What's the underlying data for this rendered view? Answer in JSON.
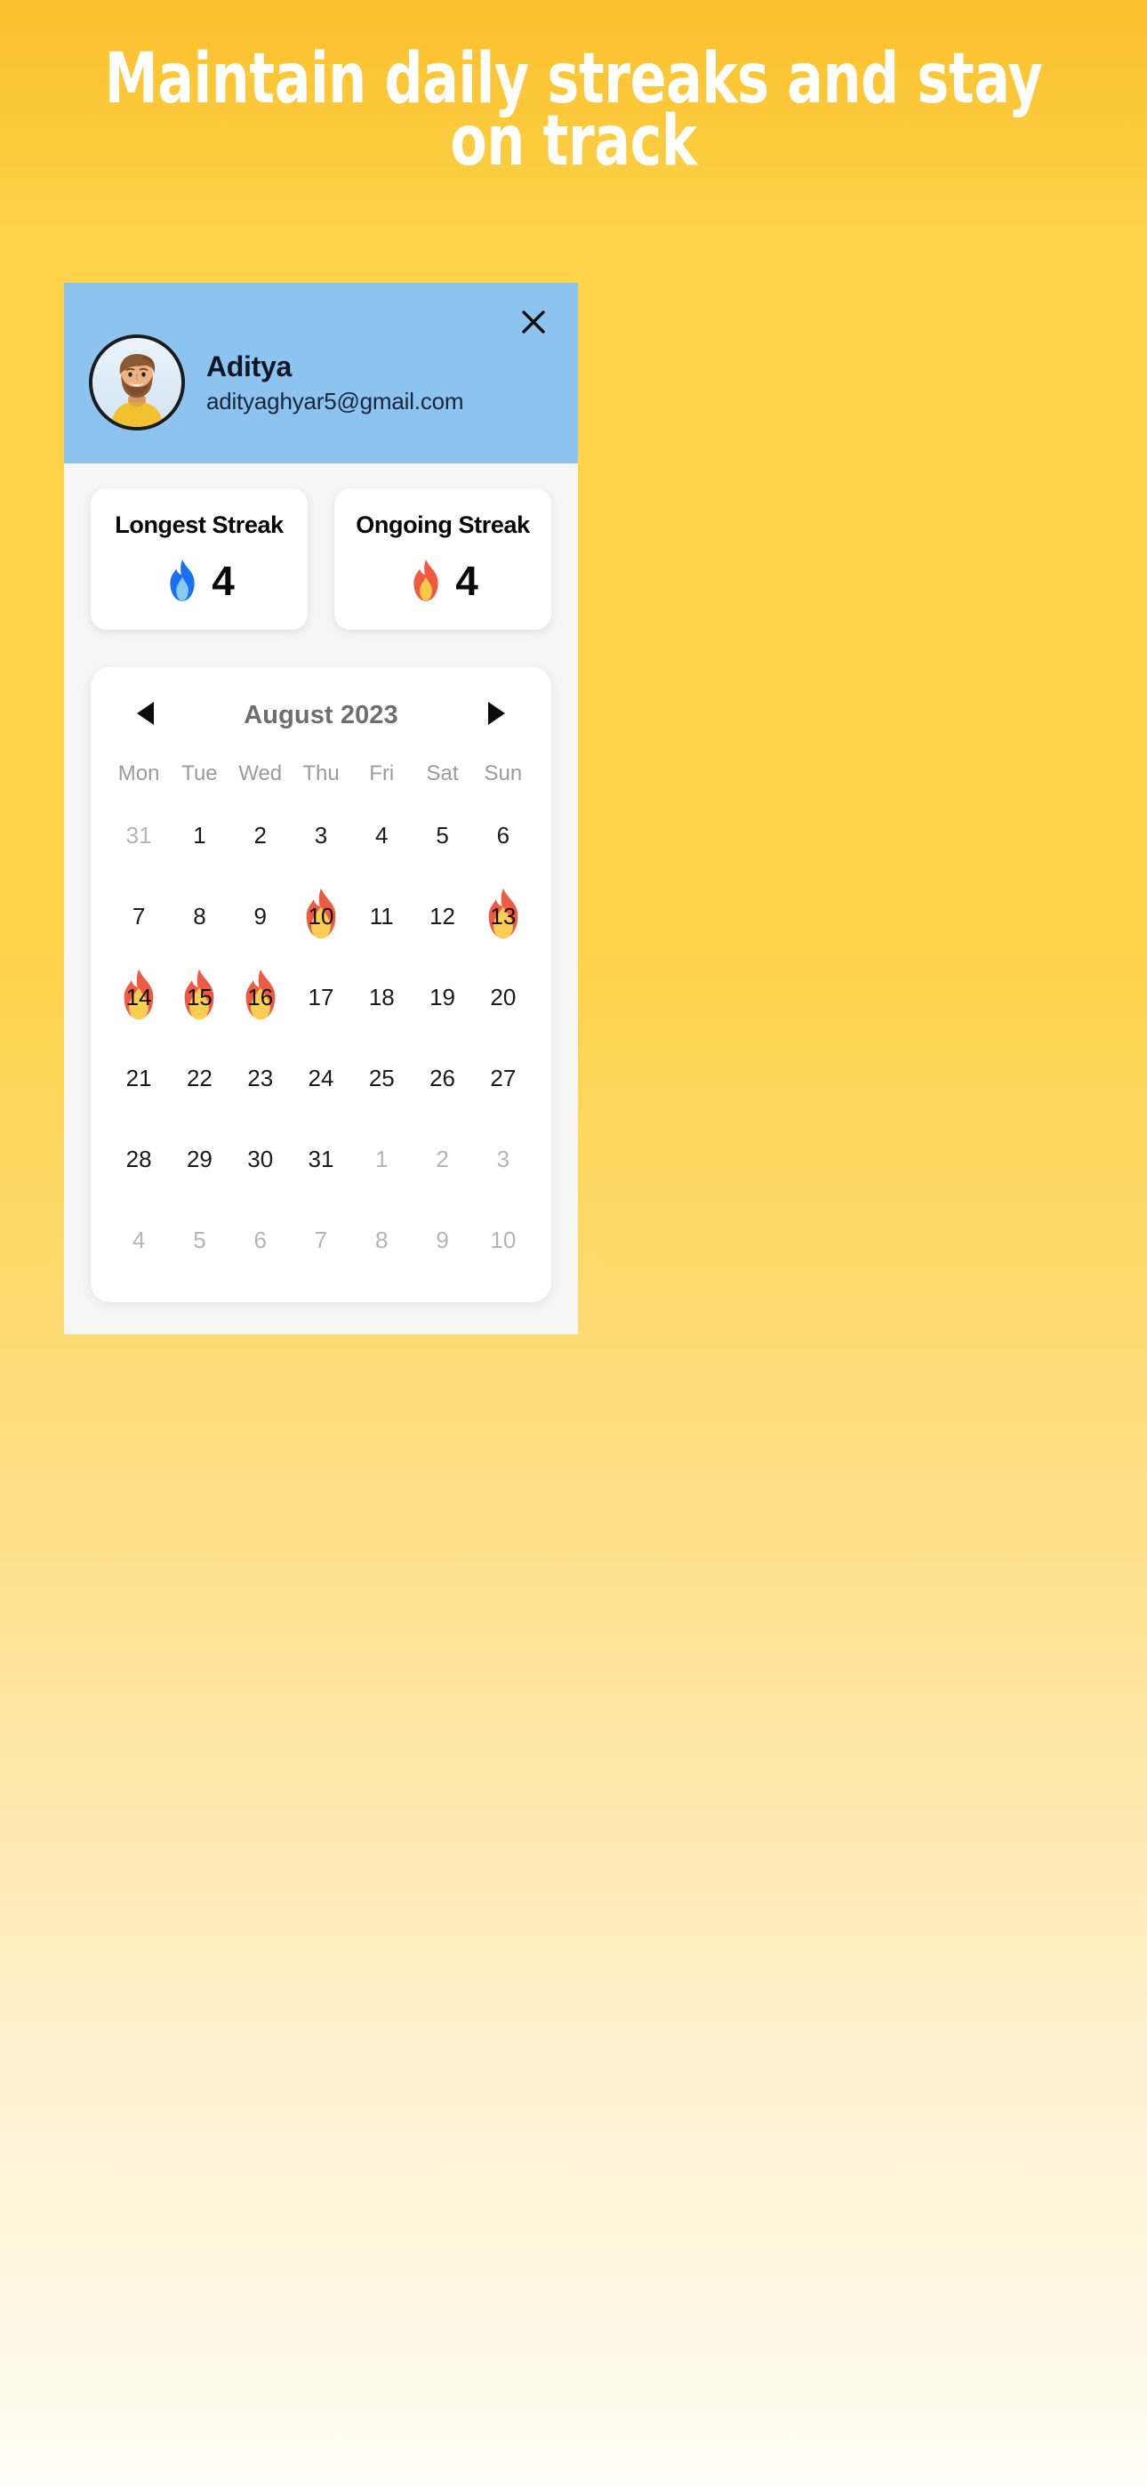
{
  "headline": "Maintain daily streaks and stay\non track",
  "colors": {
    "background_top": "#FBC02D",
    "background_bottom": "#FFFDF6",
    "profile_header": "#8CC3EF",
    "sheet": "#F6F6F6",
    "card": "#FFFFFF",
    "muted_text": "#B5B5B5",
    "title_gray": "#6E6E6E"
  },
  "profile": {
    "close_icon": "close-icon",
    "avatar_icon": "avatar-bearded-man",
    "name": "Aditya",
    "email": "adityaghyar5@gmail.com"
  },
  "streaks": [
    {
      "title": "Longest Streak",
      "icon": "blue-flame-icon",
      "count": "4"
    },
    {
      "title": "Ongoing Streak",
      "icon": "orange-flame-icon",
      "count": "4"
    }
  ],
  "calendar": {
    "prev_icon": "triangle-left-icon",
    "next_icon": "triangle-right-icon",
    "title": "August 2023",
    "weekdays": [
      "Mon",
      "Tue",
      "Wed",
      "Thu",
      "Fri",
      "Sat",
      "Sun"
    ],
    "weeks": [
      [
        {
          "day": "31",
          "muted": true,
          "marked": false
        },
        {
          "day": "1",
          "muted": false,
          "marked": false
        },
        {
          "day": "2",
          "muted": false,
          "marked": false
        },
        {
          "day": "3",
          "muted": false,
          "marked": false
        },
        {
          "day": "4",
          "muted": false,
          "marked": false
        },
        {
          "day": "5",
          "muted": false,
          "marked": false
        },
        {
          "day": "6",
          "muted": false,
          "marked": false
        }
      ],
      [
        {
          "day": "7",
          "muted": false,
          "marked": false
        },
        {
          "day": "8",
          "muted": false,
          "marked": false
        },
        {
          "day": "9",
          "muted": false,
          "marked": false
        },
        {
          "day": "10",
          "muted": false,
          "marked": true
        },
        {
          "day": "11",
          "muted": false,
          "marked": false
        },
        {
          "day": "12",
          "muted": false,
          "marked": false
        },
        {
          "day": "13",
          "muted": false,
          "marked": true
        }
      ],
      [
        {
          "day": "14",
          "muted": false,
          "marked": true
        },
        {
          "day": "15",
          "muted": false,
          "marked": true
        },
        {
          "day": "16",
          "muted": false,
          "marked": true
        },
        {
          "day": "17",
          "muted": false,
          "marked": false
        },
        {
          "day": "18",
          "muted": false,
          "marked": false
        },
        {
          "day": "19",
          "muted": false,
          "marked": false
        },
        {
          "day": "20",
          "muted": false,
          "marked": false
        }
      ],
      [
        {
          "day": "21",
          "muted": false,
          "marked": false
        },
        {
          "day": "22",
          "muted": false,
          "marked": false
        },
        {
          "day": "23",
          "muted": false,
          "marked": false
        },
        {
          "day": "24",
          "muted": false,
          "marked": false
        },
        {
          "day": "25",
          "muted": false,
          "marked": false
        },
        {
          "day": "26",
          "muted": false,
          "marked": false
        },
        {
          "day": "27",
          "muted": false,
          "marked": false
        }
      ],
      [
        {
          "day": "28",
          "muted": false,
          "marked": false
        },
        {
          "day": "29",
          "muted": false,
          "marked": false
        },
        {
          "day": "30",
          "muted": false,
          "marked": false
        },
        {
          "day": "31",
          "muted": false,
          "marked": false
        },
        {
          "day": "1",
          "muted": true,
          "marked": false
        },
        {
          "day": "2",
          "muted": true,
          "marked": false
        },
        {
          "day": "3",
          "muted": true,
          "marked": false
        }
      ],
      [
        {
          "day": "4",
          "muted": true,
          "marked": false
        },
        {
          "day": "5",
          "muted": true,
          "marked": false
        },
        {
          "day": "6",
          "muted": true,
          "marked": false
        },
        {
          "day": "7",
          "muted": true,
          "marked": false
        },
        {
          "day": "8",
          "muted": true,
          "marked": false
        },
        {
          "day": "9",
          "muted": true,
          "marked": false
        },
        {
          "day": "10",
          "muted": true,
          "marked": false
        }
      ]
    ]
  }
}
